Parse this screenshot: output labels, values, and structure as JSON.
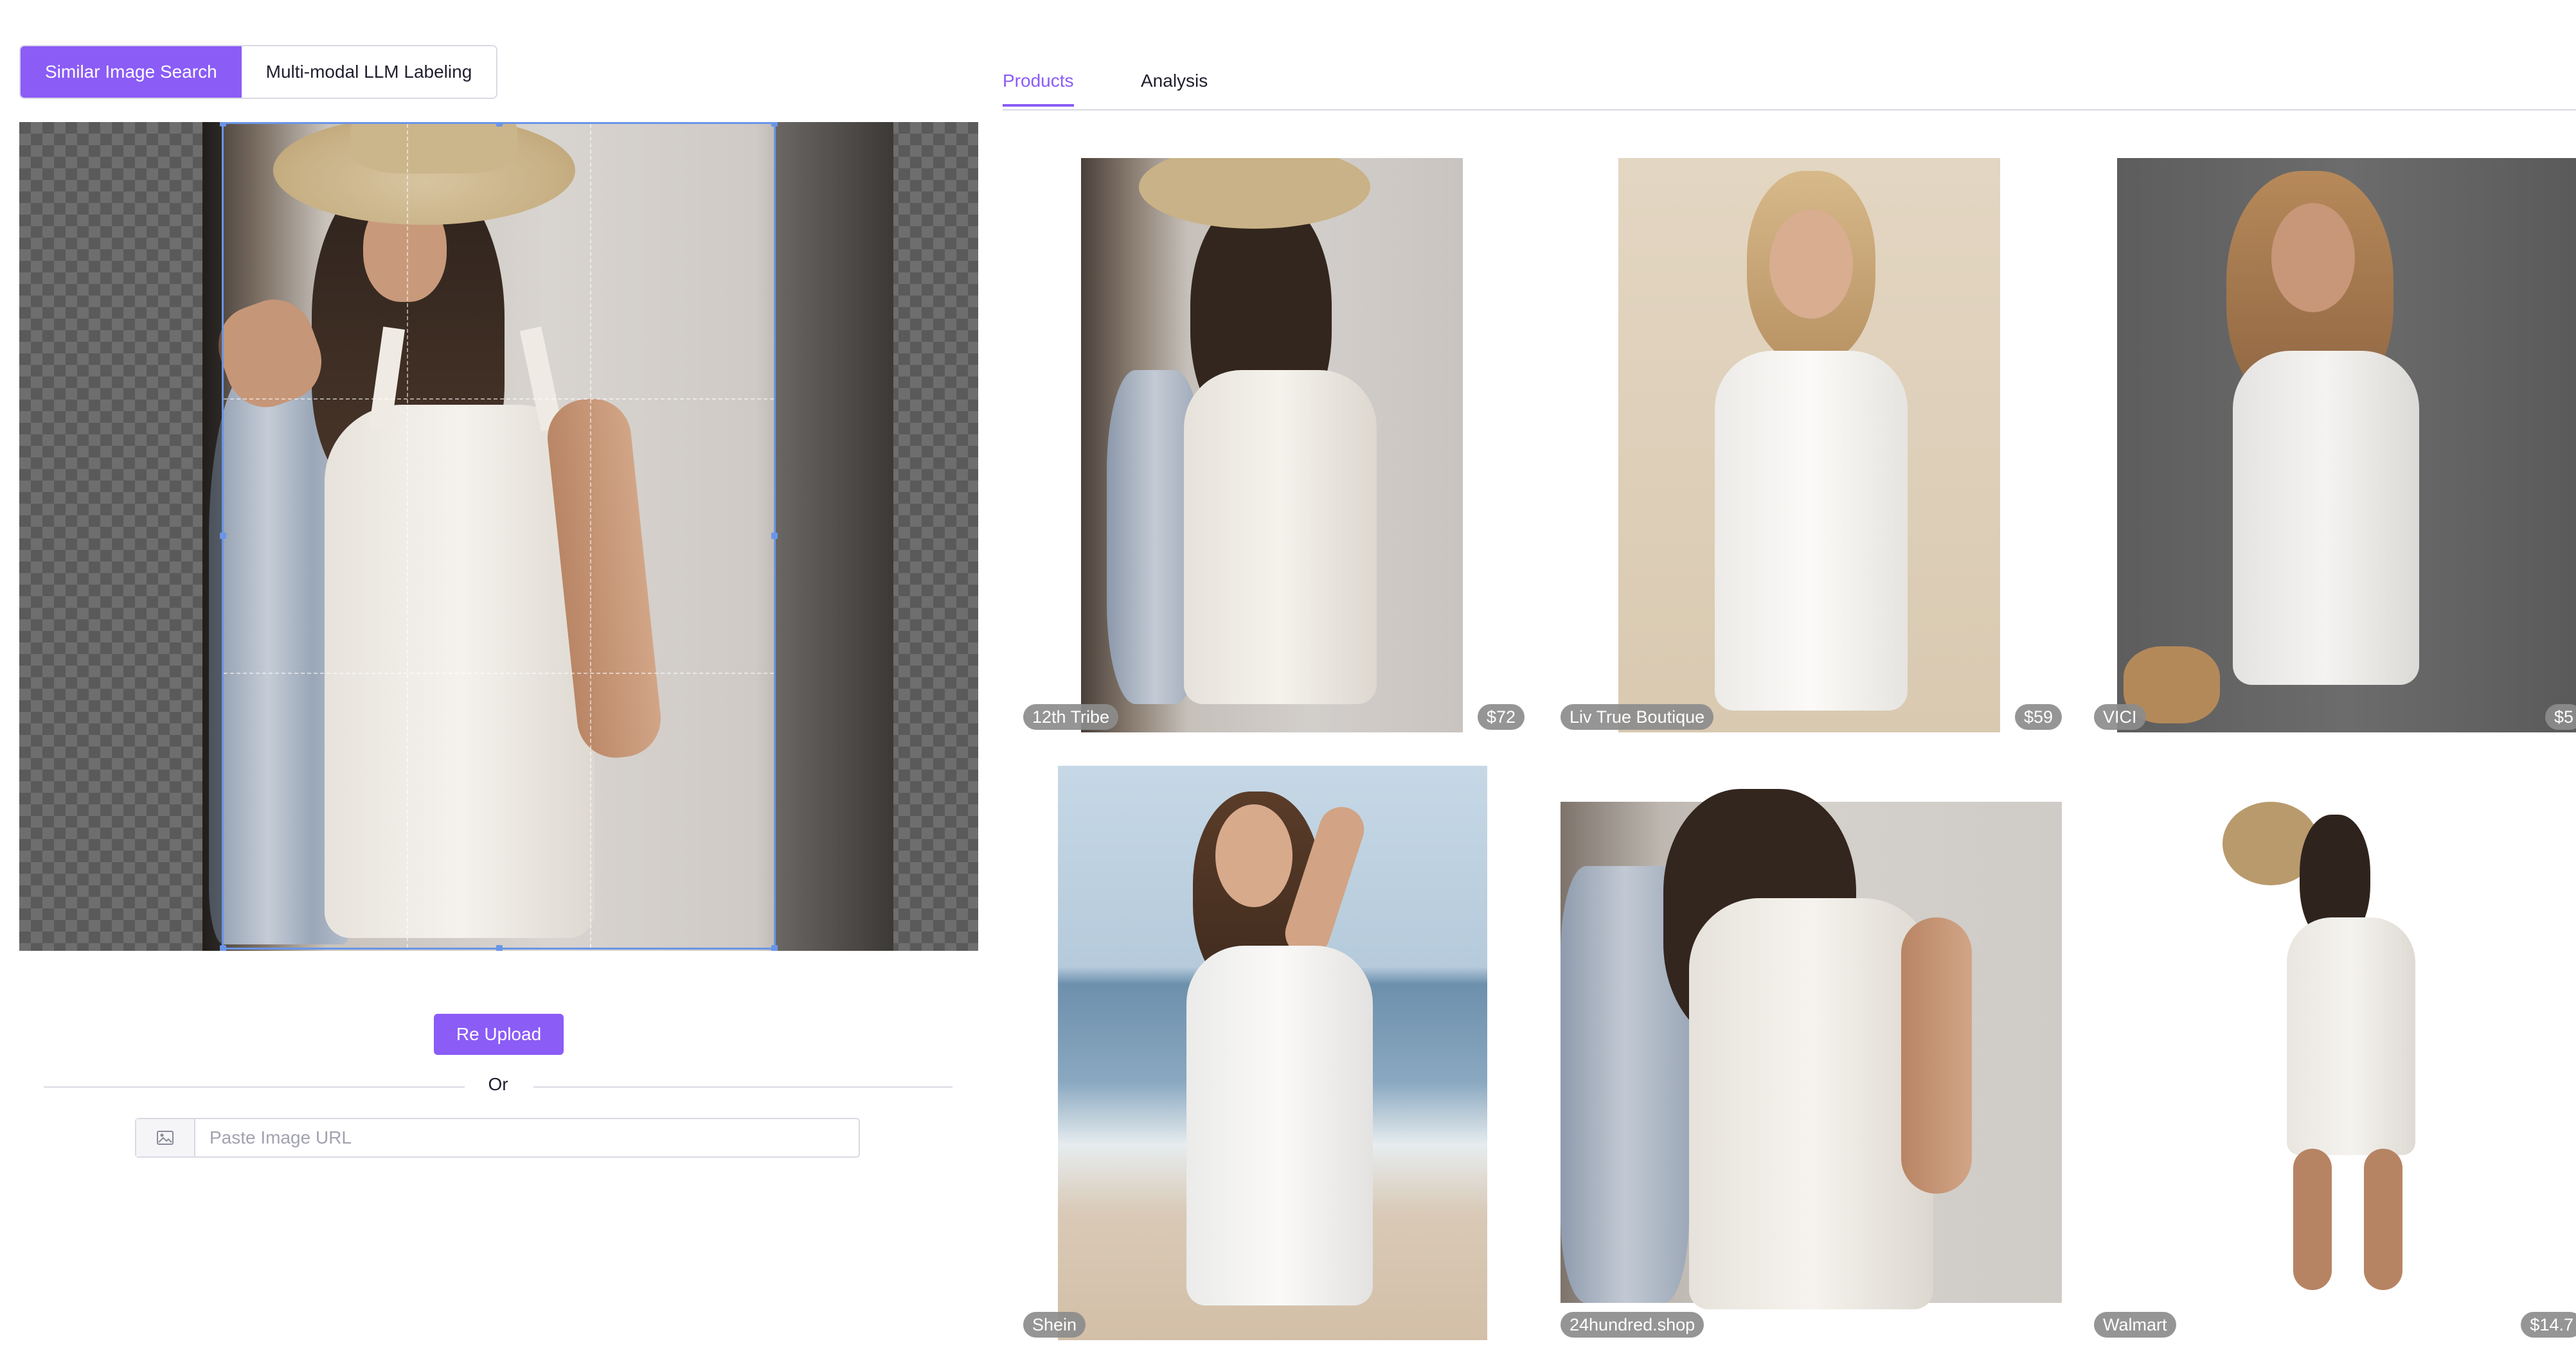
{
  "mode_switch": {
    "options": [
      "Similar Image Search",
      "Multi-modal LLM Labeling"
    ],
    "active": "Similar Image Search"
  },
  "upload": {
    "reupload_label": "Re Upload",
    "or_label": "Or",
    "url_placeholder": "Paste Image URL"
  },
  "tabs": {
    "items": [
      "Products",
      "Analysis"
    ],
    "active": "Products"
  },
  "products": [
    {
      "store": "12th Tribe",
      "price": "$72"
    },
    {
      "store": "Liv True Boutique",
      "price": "$59"
    },
    {
      "store": "VICI",
      "price": "$5"
    },
    {
      "store": "Shein",
      "price": ""
    },
    {
      "store": "24hundred.shop",
      "price": ""
    },
    {
      "store": "Walmart",
      "price": "$14.7"
    }
  ],
  "colors": {
    "accent": "#8b5cf6",
    "crop_border": "#6a95e8",
    "pill_bg": "#8c8c8c"
  },
  "icons": {
    "url_field": "image-icon"
  }
}
